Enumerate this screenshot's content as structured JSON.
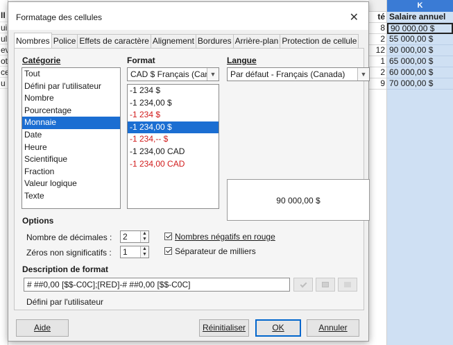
{
  "dialog": {
    "title": "Formatage des cellules",
    "close_glyph": "✕",
    "tabs": [
      "Nombres",
      "Police",
      "Effets de caractère",
      "Alignement",
      "Bordures",
      "Arrière-plan",
      "Protection de cellule"
    ],
    "category": {
      "label": "Catégorie",
      "items": [
        "Tout",
        "Défini par l'utilisateur",
        "Nombre",
        "Pourcentage",
        "Monnaie",
        "Date",
        "Heure",
        "Scientifique",
        "Fraction",
        "Valeur logique",
        "Texte"
      ],
      "selected_index": 4
    },
    "format": {
      "label": "Format",
      "currency_combo": "CAD  $  Français (Canada)",
      "items": [
        {
          "text": "-1 234 $",
          "red": false
        },
        {
          "text": "-1 234,00 $",
          "red": false
        },
        {
          "text": "-1 234 $",
          "red": true
        },
        {
          "text": "-1 234,00 $",
          "red": false
        },
        {
          "text": "-1 234,-- $",
          "red": true
        },
        {
          "text": "-1 234,00 CAD",
          "red": false
        },
        {
          "text": "-1 234,00 CAD",
          "red": true
        }
      ],
      "selected_index": 3
    },
    "language": {
      "label": "Langue",
      "value": "Par défaut - Français (Canada)"
    },
    "preview": "90 000,00 $",
    "options": {
      "label": "Options",
      "decimals_label": "Nombre de décimales :",
      "decimals_value": "2",
      "leading_zeros_label": "Zéros non significatifs :",
      "leading_zeros_value": "1",
      "negative_red_label": "Nombres négatifs en rouge",
      "thousands_sep_label": "Séparateur de milliers"
    },
    "format_code": {
      "label": "Description de format",
      "value": "# ##0,00 [$$-C0C];[RED]-# ##0,00 [$$-C0C]",
      "comment": "Défini par l'utilisateur"
    },
    "buttons": {
      "help": "Aide",
      "reset": "Réinitialiser",
      "ok": "OK",
      "cancel": "Annuler"
    }
  },
  "sheet": {
    "left_cells": [
      "II",
      "ui",
      "ul",
      "ev",
      "ot",
      "ce",
      "u"
    ],
    "col_j_header": "té",
    "col_j": [
      "8",
      "2",
      "12",
      "1",
      "2",
      "9"
    ],
    "col_k_letter": "K",
    "col_k_header": "Salaire annuel",
    "col_k": [
      "90 000,00 $",
      "55 000,00 $",
      "90 000,00 $",
      "65 000,00 $",
      "60 000,00 $",
      "70 000,00 $"
    ]
  },
  "colors": {
    "selection": "#1b6ed2",
    "negative": "#d11b1b",
    "column_highlight": "#cfe0f3",
    "header_highlight": "#3a7bd5"
  }
}
